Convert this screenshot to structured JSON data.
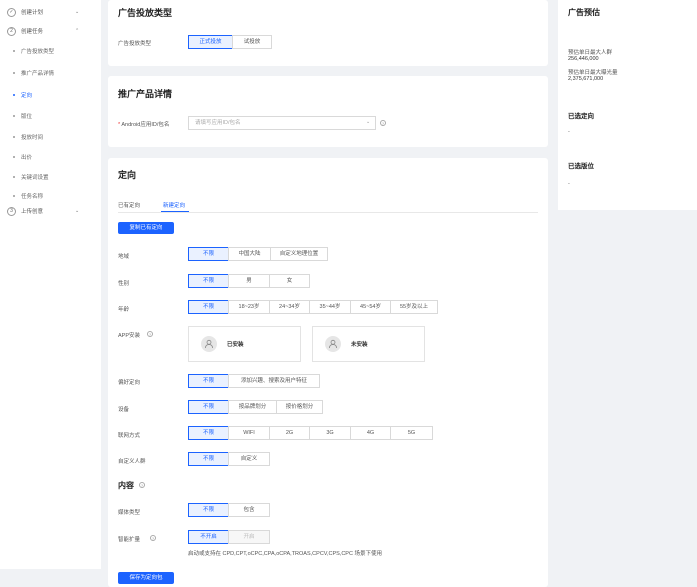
{
  "sidebar": {
    "items": [
      {
        "icon": "check",
        "label": "创建计划"
      },
      {
        "icon": "2",
        "label": "创建任务"
      },
      {
        "icon": "3",
        "label": "上传创意"
      }
    ],
    "subitems": [
      "广告投放类型",
      "推广产品详情",
      "定向",
      "版位",
      "投放时间",
      "出价",
      "关键词设置",
      "任务名称"
    ],
    "active_index": 2
  },
  "ad_type_card": {
    "title": "广告投放类型",
    "label": "广告投放类型",
    "options": [
      "正式投放",
      "试投放"
    ],
    "selected": 0
  },
  "product_card": {
    "title": "推广产品详情",
    "label": "Android应用ID/包名",
    "required_mark": "*",
    "placeholder": "请填写应用ID/包名"
  },
  "targeting_card": {
    "title": "定向",
    "tabs": [
      "已有定向",
      "新建定向"
    ],
    "active_tab": 1,
    "copy_button": "复制已有定向",
    "region": {
      "label": "地域",
      "options": [
        "不限",
        "中国大陆",
        "自定义地理位置"
      ]
    },
    "gender": {
      "label": "性别",
      "options": [
        "不限",
        "男",
        "女"
      ]
    },
    "age": {
      "label": "年龄",
      "options": [
        "不限",
        "18~23岁",
        "24~34岁",
        "35~44岁",
        "45~54岁",
        "55岁及以上"
      ]
    },
    "app_install": {
      "label": "APP安装",
      "options": [
        "已安装",
        "未安装"
      ]
    },
    "audience": {
      "label": "偏好定向",
      "options": [
        "不限",
        "添加兴趣、搜索及用户特征"
      ]
    },
    "device": {
      "label": "设备",
      "options": [
        "不限",
        "按品牌划分",
        "按价格划分"
      ]
    },
    "network": {
      "label": "联网方式",
      "options": [
        "不限",
        "WIFI",
        "2G",
        "3G",
        "4G",
        "5G"
      ]
    },
    "custom_audience": {
      "label": "自定义人群",
      "options": [
        "不限",
        "自定义"
      ]
    },
    "content_title": "内容",
    "content_type": {
      "label": "媒体类型",
      "options": [
        "不限",
        "包含"
      ]
    },
    "smart_expand": {
      "label": "智能扩量",
      "options": [
        "不开启",
        "开启"
      ]
    },
    "smart_note": "启动或支持在 CPD,CPT,oCPC,CPA,oCPA,TROAS,CPCV,CPS,CPC 场景下使用",
    "save_button": "保存为定向包"
  },
  "estimate": {
    "title": "广告预估",
    "users_label": "预估单日最大人群",
    "users_value": "256,446,000",
    "impressions_label": "预估单日最大曝光量",
    "impressions_value": "2,375,671,000",
    "selected_targeting_title": "已选定向",
    "selected_targeting_value": "-",
    "selected_slot_title": "已选版位",
    "selected_slot_value": "-"
  }
}
